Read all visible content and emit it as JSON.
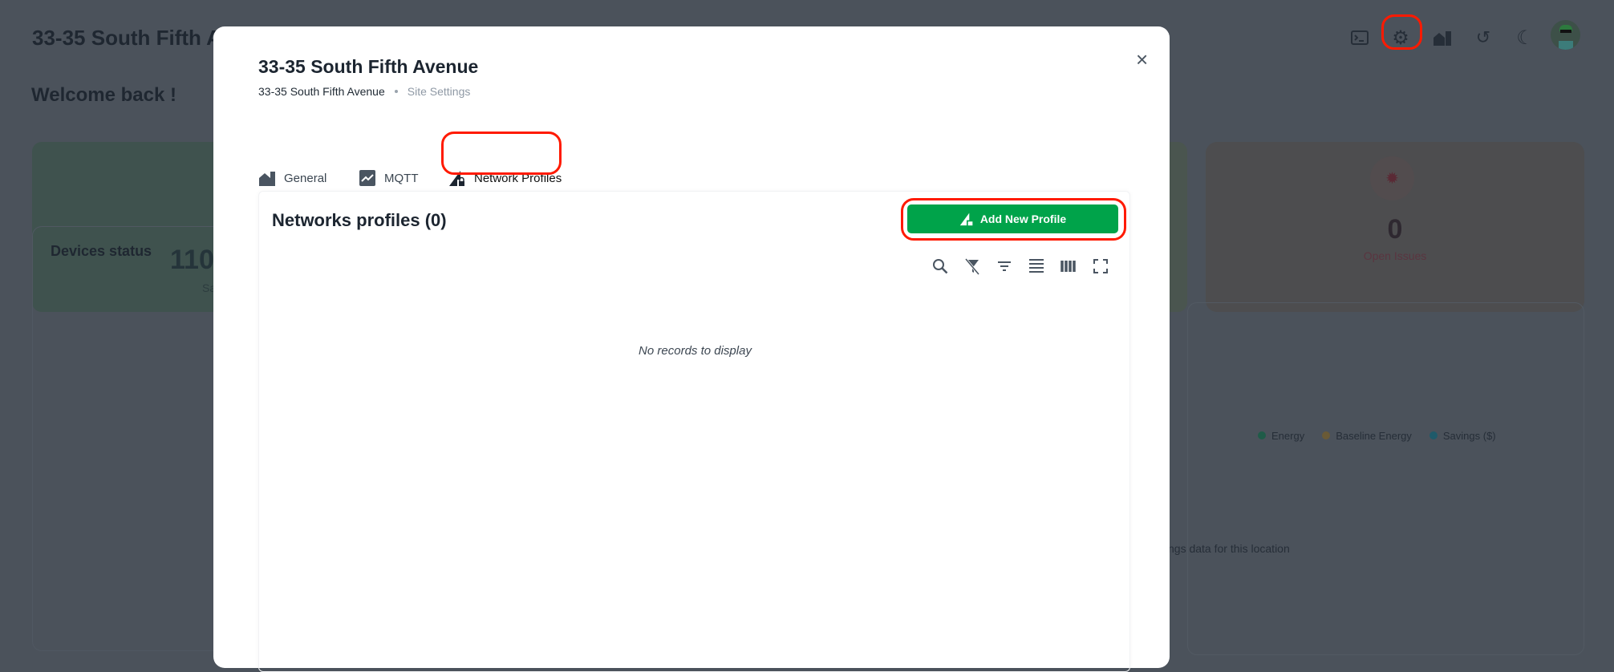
{
  "background": {
    "header_title": "33-35 South Fifth A",
    "welcome": "Welcome back !",
    "stat_left_value": "110",
    "stat_left_label": "Sa",
    "stat_right_value": "0",
    "stat_right_label": "Open Issues",
    "devices_status": "Devices status",
    "legend": [
      {
        "label": "Energy",
        "color": "#1f5b48"
      },
      {
        "label": "Baseline Energy",
        "color": "#6a5a36"
      },
      {
        "label": "Savings ($)",
        "color": "#1f5a6a"
      }
    ],
    "chart_message": "ngs data for this location",
    "header_icons": [
      "terminal-icon",
      "gear-icon",
      "buildings-icon",
      "refresh-icon",
      "moon-icon",
      "avatar"
    ]
  },
  "modal": {
    "title": "33-35 South Fifth Avenue",
    "breadcrumb": [
      "33-35 South Fifth Avenue",
      "Site Settings"
    ],
    "tabs": [
      {
        "label": "General",
        "icon": "buildings-icon"
      },
      {
        "label": "MQTT",
        "icon": "chart-icon"
      },
      {
        "label": "Network Profiles",
        "icon": "signal-lock-icon",
        "active": true
      }
    ],
    "card_title": "Networks profiles (0)",
    "add_button": "Add New Profile",
    "accent": "#00a34a",
    "toolbar": [
      "search-icon",
      "clear-filter-icon",
      "filter-icon",
      "density-icon",
      "columns-icon",
      "fullscreen-icon"
    ],
    "empty_message": "No records to display"
  }
}
